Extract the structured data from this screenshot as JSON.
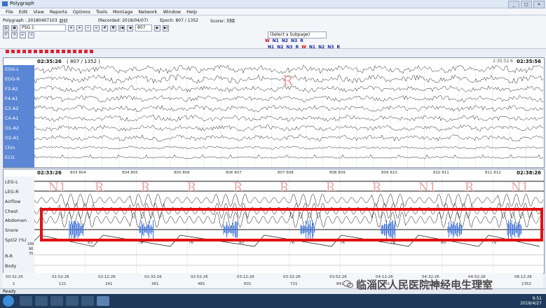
{
  "window": {
    "title": "Polygraph",
    "buttons": [
      "_",
      "□",
      "×"
    ]
  },
  "menu": [
    "File",
    "Edit",
    "View",
    "Reports",
    "Options",
    "Tools",
    "Montage",
    "Network",
    "Window",
    "Help"
  ],
  "toolbar": {
    "file_tab": "Polygraph : 20180407103",
    "patient": "赵欣",
    "montage": "PSG 1",
    "recorded": "(Recorded: 2018/04/07)",
    "epoch": "Epoch: 807 / 1352",
    "scorer": "Scorer: 刘晓",
    "epoch_field": "807",
    "scoring_select": "(Select a Subpage)",
    "stages_top": [
      "W",
      "N1",
      "N2",
      "N3",
      "R"
    ],
    "stages_bottom": [
      "N1",
      "N2",
      "N3",
      "R",
      "W",
      "N1",
      "N2",
      "N3",
      "R"
    ]
  },
  "panel1": {
    "time_left": "02:35:26",
    "epoch_counter": "( 807 / 1352 )",
    "time_mid": "2:35:52.6",
    "time_right": "02:35:56",
    "stage_mark": "R",
    "channels": [
      "EOG-L",
      "EOG-R",
      "F3-A2",
      "F4-A1",
      "C3-A2",
      "C4-A1",
      "O1-A2",
      "O2-A1",
      "Chin",
      "ECG"
    ]
  },
  "panel2": {
    "time_left": "02:33:26",
    "time_right": "02:38:26",
    "epoch_ticks": [
      "803 804",
      "804 805",
      "805 806",
      "806 807",
      "807 808",
      "808 809",
      "809 810",
      "810 811",
      "811 812"
    ],
    "stage_marks": [
      "N1",
      "R",
      "R",
      "R",
      "R",
      "R",
      "R",
      "R",
      "N1",
      "R",
      "N1"
    ],
    "channels": [
      "LEG-L",
      "LEG-R",
      "Airflow",
      "Chest",
      "Abdomen",
      "Snore",
      "SpO2 (%)",
      "R-R",
      "Body"
    ],
    "spo2_scale": [
      "100",
      "90",
      "75"
    ],
    "spo2_values": [
      "83",
      "78",
      "76",
      "80",
      "78",
      "76",
      "78",
      "80",
      "79"
    ]
  },
  "xaxis_times": [
    "00:32:26",
    "01:52:26",
    "02:12:26",
    "02:32:26",
    "02:52:26",
    "03:12:26",
    "03:32:26",
    "03:52:26",
    "04:12:26",
    "04:32:26",
    "04:52:26",
    "06:12:26"
  ],
  "xaxis_counts": [
    "1",
    "121",
    "241",
    "361",
    "481",
    "601",
    "721",
    "841",
    "961",
    "1081",
    "1201",
    "1352"
  ],
  "status": "Ready",
  "clock": {
    "time": "9:51",
    "date": "2018/4/27"
  },
  "watermark": "临淄区人民医院神经电生理室",
  "colors": {
    "highlight_box": "#e21010",
    "eeg_label_bg": "#5b86d6",
    "snore_burst": "#3a6fd8",
    "stage_mark": "#e9a3a3"
  }
}
